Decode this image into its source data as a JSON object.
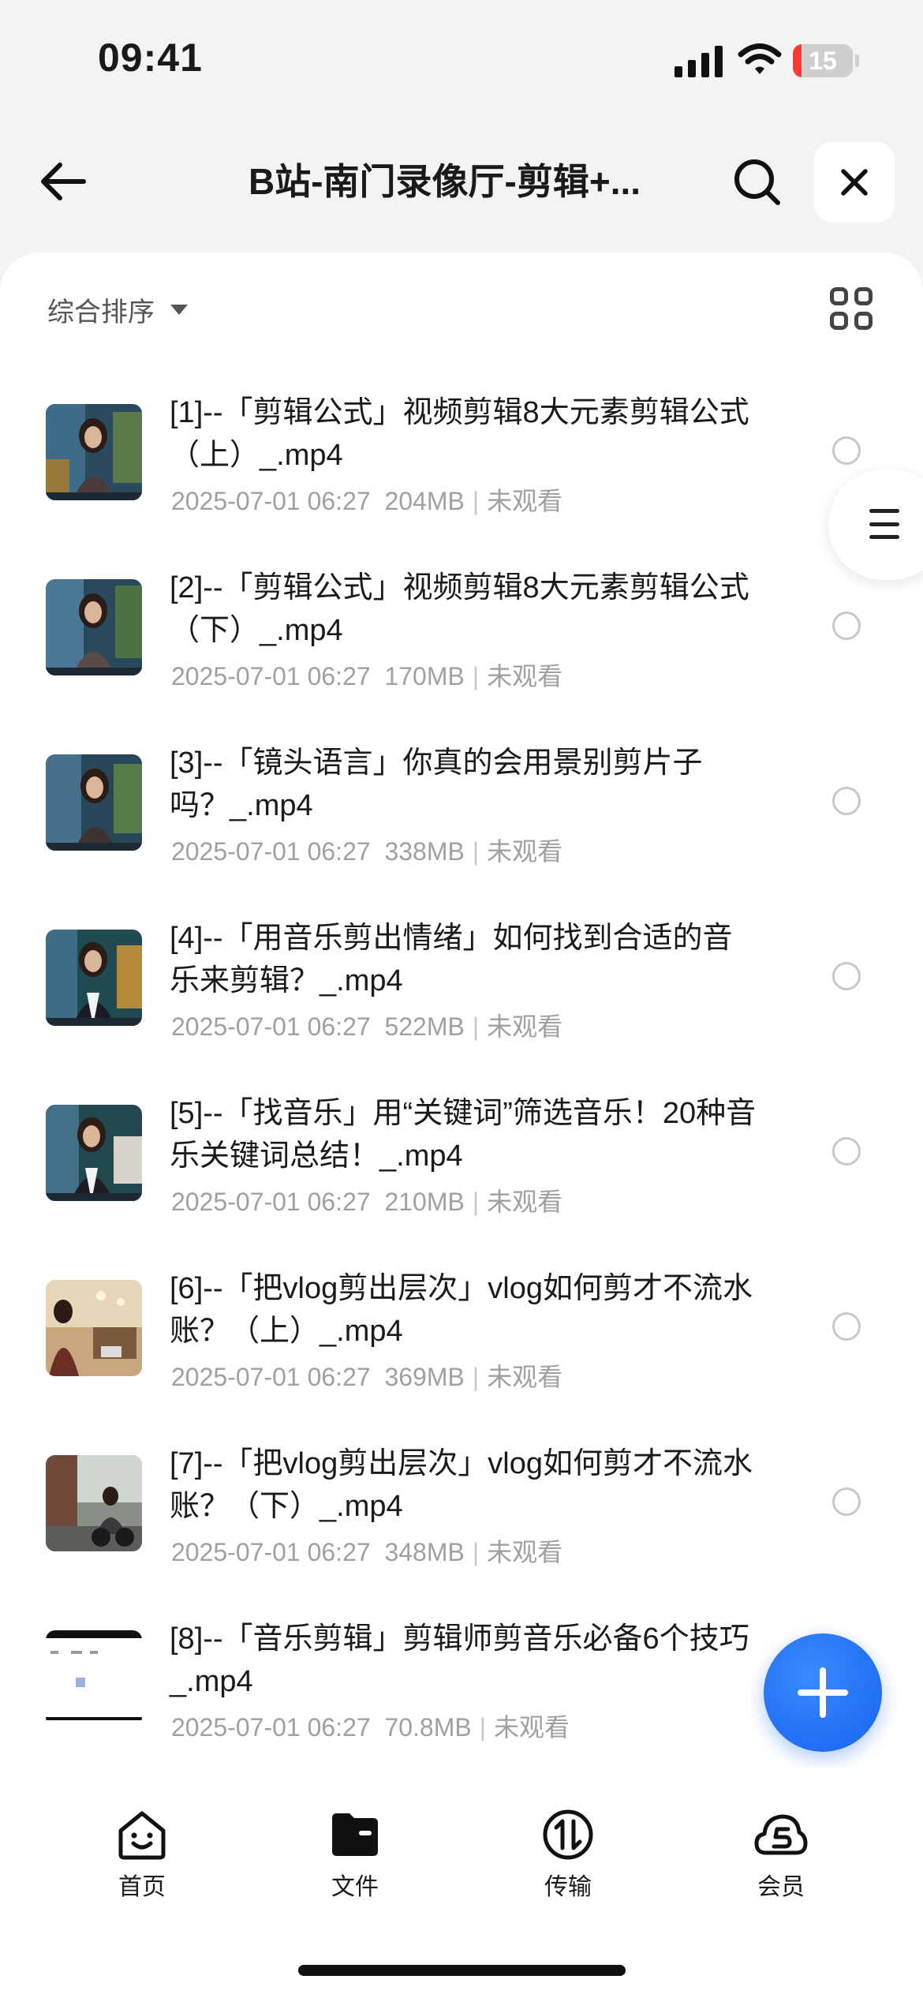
{
  "status_bar": {
    "time": "09:41",
    "battery": "15",
    "battery_level": 0.15
  },
  "header": {
    "title": "B站-南门录像厅-剪辑+...",
    "icons": [
      "arrow-left-icon",
      "search-icon",
      "close-icon"
    ]
  },
  "toolbar": {
    "sort_label": "综合排序"
  },
  "files": [
    {
      "name": "[1]--「剪辑公式」视频剪辑8大元素剪辑公式（上）_.mp4",
      "date": "2025-07-01 06:27",
      "size": "204MB",
      "status": "未观看"
    },
    {
      "name": "[2]--「剪辑公式」视频剪辑8大元素剪辑公式（下）_.mp4",
      "date": "2025-07-01 06:27",
      "size": "170MB",
      "status": "未观看"
    },
    {
      "name": "[3]--「镜头语言」你真的会用景别剪片子吗？_.mp4",
      "date": "2025-07-01 06:27",
      "size": "338MB",
      "status": "未观看"
    },
    {
      "name": "[4]--「用音乐剪出情绪」如何找到合适的音乐来剪辑？_.mp4",
      "date": "2025-07-01 06:27",
      "size": "522MB",
      "status": "未观看"
    },
    {
      "name": "[5]--「找音乐」用“关键词”筛选音乐！20种音乐关键词总结！_.mp4",
      "date": "2025-07-01 06:27",
      "size": "210MB",
      "status": "未观看"
    },
    {
      "name": "[6]--「把vlog剪出层次」vlog如何剪才不流水账？（上）_.mp4",
      "date": "2025-07-01 06:27",
      "size": "369MB",
      "status": "未观看"
    },
    {
      "name": "[7]--「把vlog剪出层次」vlog如何剪才不流水账？（下）_.mp4",
      "date": "2025-07-01 06:27",
      "size": "348MB",
      "status": "未观看"
    },
    {
      "name": "[8]--「音乐剪辑」剪辑师剪音乐必备6个技巧_.mp4",
      "date": "2025-07-01 06:27",
      "size": "70.8MB",
      "status": "未观看"
    }
  ],
  "bottom_nav": [
    {
      "label": "首页",
      "icon": "home-icon"
    },
    {
      "label": "文件",
      "icon": "folder-icon"
    },
    {
      "label": "传输",
      "icon": "transfer-icon"
    },
    {
      "label": "会员",
      "icon": "vip-cloud-icon"
    }
  ],
  "colors": {
    "accent": "#1663f0",
    "meta": "#a0a0a0",
    "battery_low": "#ff3b30"
  }
}
